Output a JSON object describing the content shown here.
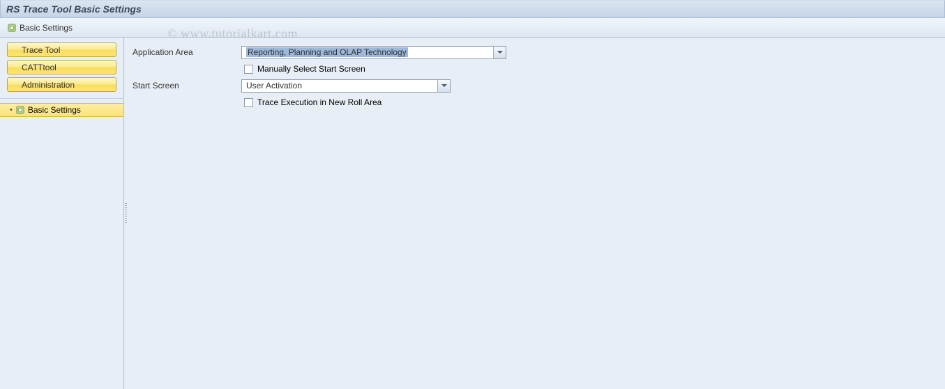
{
  "title": "RS Trace Tool Basic Settings",
  "toolbar": {
    "basic_settings": "Basic Settings"
  },
  "sidebar": {
    "buttons": [
      {
        "label": "Trace Tool"
      },
      {
        "label": "CATTtool"
      },
      {
        "label": "Administration"
      }
    ],
    "tree": {
      "selected_item": "Basic Settings"
    }
  },
  "form": {
    "application_area_label": "Application Area",
    "application_area_value": "Reporting, Planning and OLAP Technology",
    "manual_select_label": "Manually Select Start Screen",
    "start_screen_label": "Start Screen",
    "start_screen_value": "User Activation",
    "trace_exec_label": "Trace Execution in New Roll Area"
  },
  "watermark": "© www.tutorialkart.com"
}
